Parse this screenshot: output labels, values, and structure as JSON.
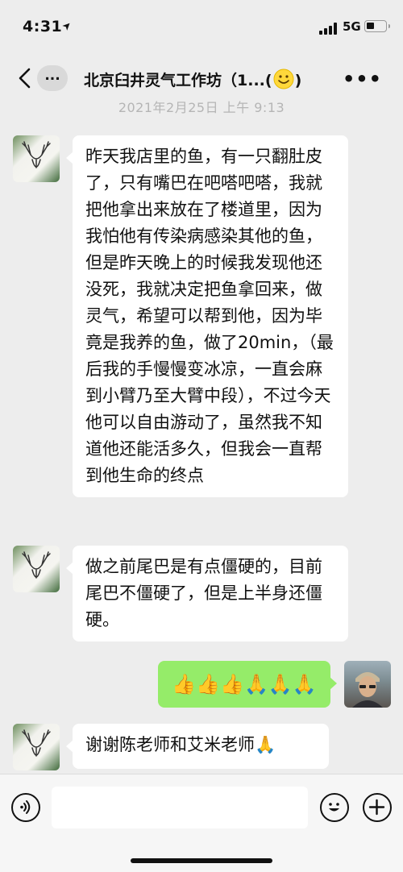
{
  "status": {
    "time": "4:31",
    "network": "5G"
  },
  "nav": {
    "unread": "...",
    "title": "北京臼井灵气工作坊（1...(",
    "more": "•••"
  },
  "timestamp": "2021年2月25日 上午 9:13",
  "messages": [
    {
      "side": "left",
      "text": "昨天我店里的鱼，有一只翻肚皮了，只有嘴巴在吧嗒吧嗒，我就把他拿出来放在了楼道里，因为我怕他有传染病感染其他的鱼，但是昨天晚上的时候我发现他还没死，我就决定把鱼拿回来，做灵气，希望可以帮到他，因为毕竟是我养的鱼，做了20min，（最后我的手慢慢变冰凉，一直会麻到小臂乃至大臂中段），不过今天他可以自由游动了，虽然我不知道他还能活多久，但我会一直帮到他生命的终点"
    },
    {
      "side": "left",
      "text": "做之前尾巴是有点僵硬的，目前尾巴不僵硬了，但是上半身还僵硬。"
    },
    {
      "side": "right",
      "emoji": "👍👍👍🙏🙏🙏"
    },
    {
      "side": "left",
      "text": "谢谢陈老师和艾米老师🙏"
    }
  ],
  "icons": {
    "back": "chevron-left-icon",
    "voice": "voice-icon",
    "emoji": "smiley-icon",
    "plus": "plus-icon",
    "group_emoji": "smiley-face-emoji"
  },
  "colors": {
    "background": "#ededed",
    "bubble_self": "#95ec69",
    "bubble_other": "#ffffff",
    "timestamp": "#b5b5b5"
  }
}
